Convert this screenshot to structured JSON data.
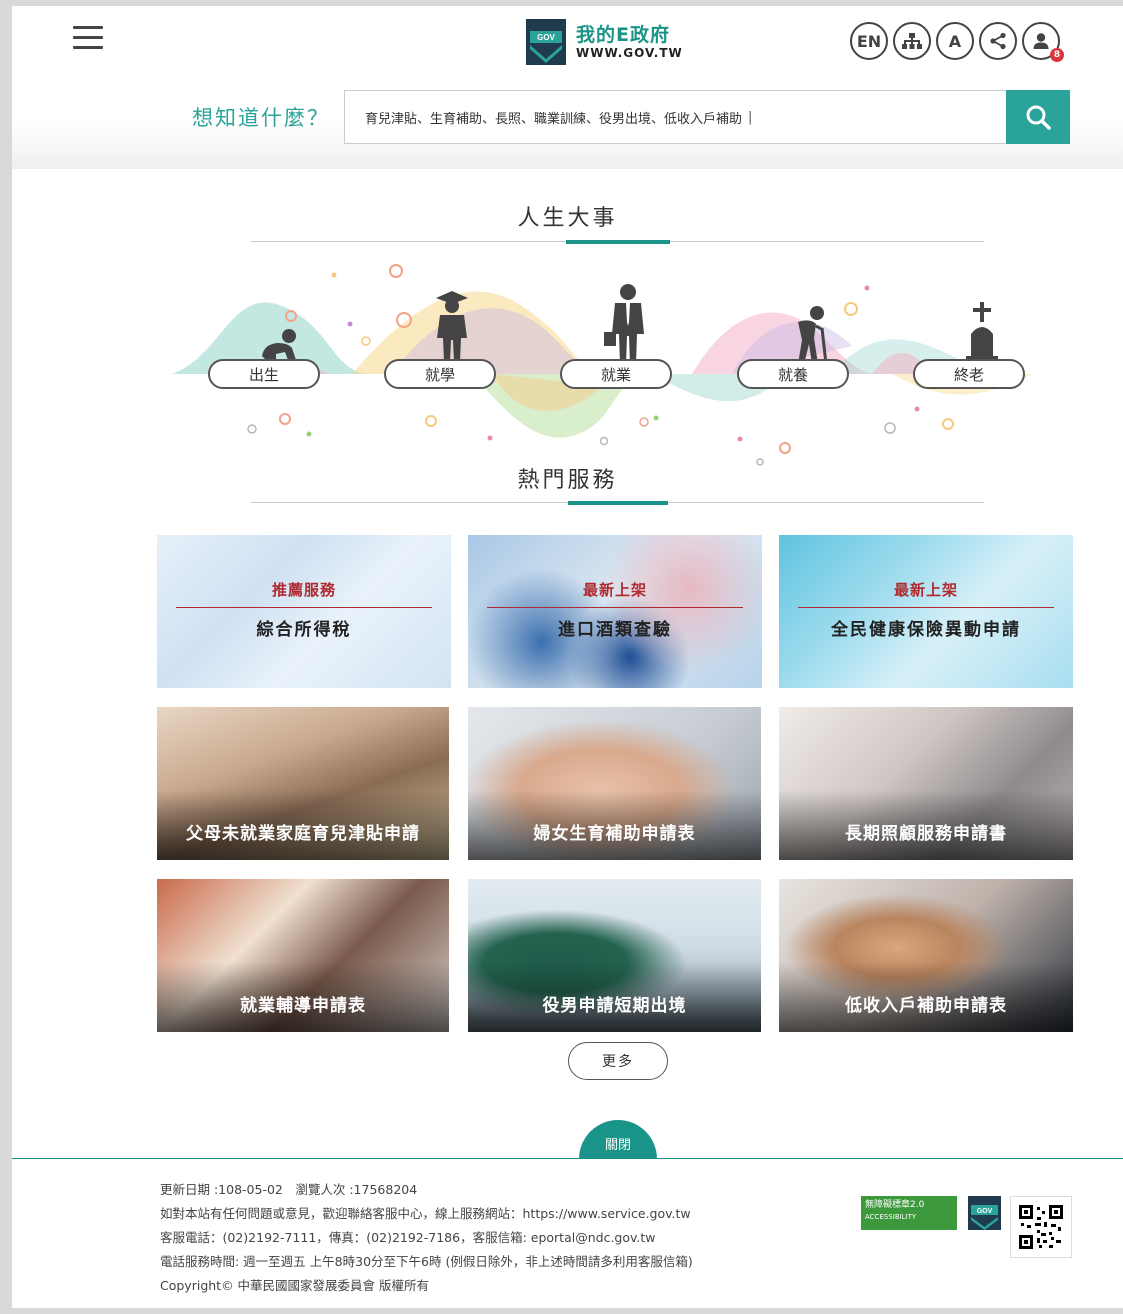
{
  "header": {
    "logo_zh": "我的E政府",
    "logo_en": "WWW.GOV.TW",
    "logo_mark_text": "GOV",
    "tools": [
      {
        "label": "EN",
        "icon": "language-icon"
      },
      {
        "label": "",
        "icon": "sitemap-icon"
      },
      {
        "label": "A",
        "icon": "font-size-icon"
      },
      {
        "label": "",
        "icon": "share-icon"
      },
      {
        "label": "",
        "icon": "user-icon",
        "badge": "8"
      }
    ]
  },
  "search": {
    "label": "想知道什麼？",
    "placeholder": "育兒津貼、生育補助、長照、職業訓練、役男出境、低收入戶補助",
    "cursor": "|"
  },
  "life": {
    "title": "人生大事",
    "stages": [
      "出生",
      "就學",
      "就業",
      "就養",
      "終老"
    ]
  },
  "hot": {
    "title": "熱門服務",
    "featured": [
      {
        "tag": "推薦服務",
        "title": "綜合所得稅"
      },
      {
        "tag": "最新上架",
        "title": "進口酒類查驗"
      },
      {
        "tag": "最新上架",
        "title": "全民健康保險異動申請"
      }
    ],
    "photos": [
      {
        "title": "父母未就業家庭育兒津貼申請"
      },
      {
        "title": "婦女生育補助申請表"
      },
      {
        "title": "長期照顧服務申請書"
      },
      {
        "title": "就業輔導申請表"
      },
      {
        "title": "役男申請短期出境"
      },
      {
        "title": "低收入戶補助申請表"
      }
    ],
    "more": "更多"
  },
  "footer": {
    "close": "關閉",
    "lines": [
      "更新日期 :108-05-02　瀏覽人次 :17568204",
      "如對本站有任何問題或意見，歡迎聯絡客服中心，線上服務網站：https://www.service.gov.tw",
      "客服電話：(02)2192-7111，傳真：(02)2192-7186，客服信箱: eportal@ndc.gov.tw",
      "電話服務時間: 週一至週五 上午8時30分至下午6時 (例假日除外，非上述時間請多利用客服信箱)",
      "Copyright© 中華民國國家發展委員會 版權所有"
    ],
    "accessibility_line1": "無障礙標章2.0",
    "accessibility_line2": "ACCESSIBILITY",
    "gov_badge": "GOV"
  },
  "colors": {
    "accent": "#1a9488",
    "search_btn": "#2aa39a",
    "feat_tag": "#b02a30",
    "badge_red": "#d9363e"
  }
}
